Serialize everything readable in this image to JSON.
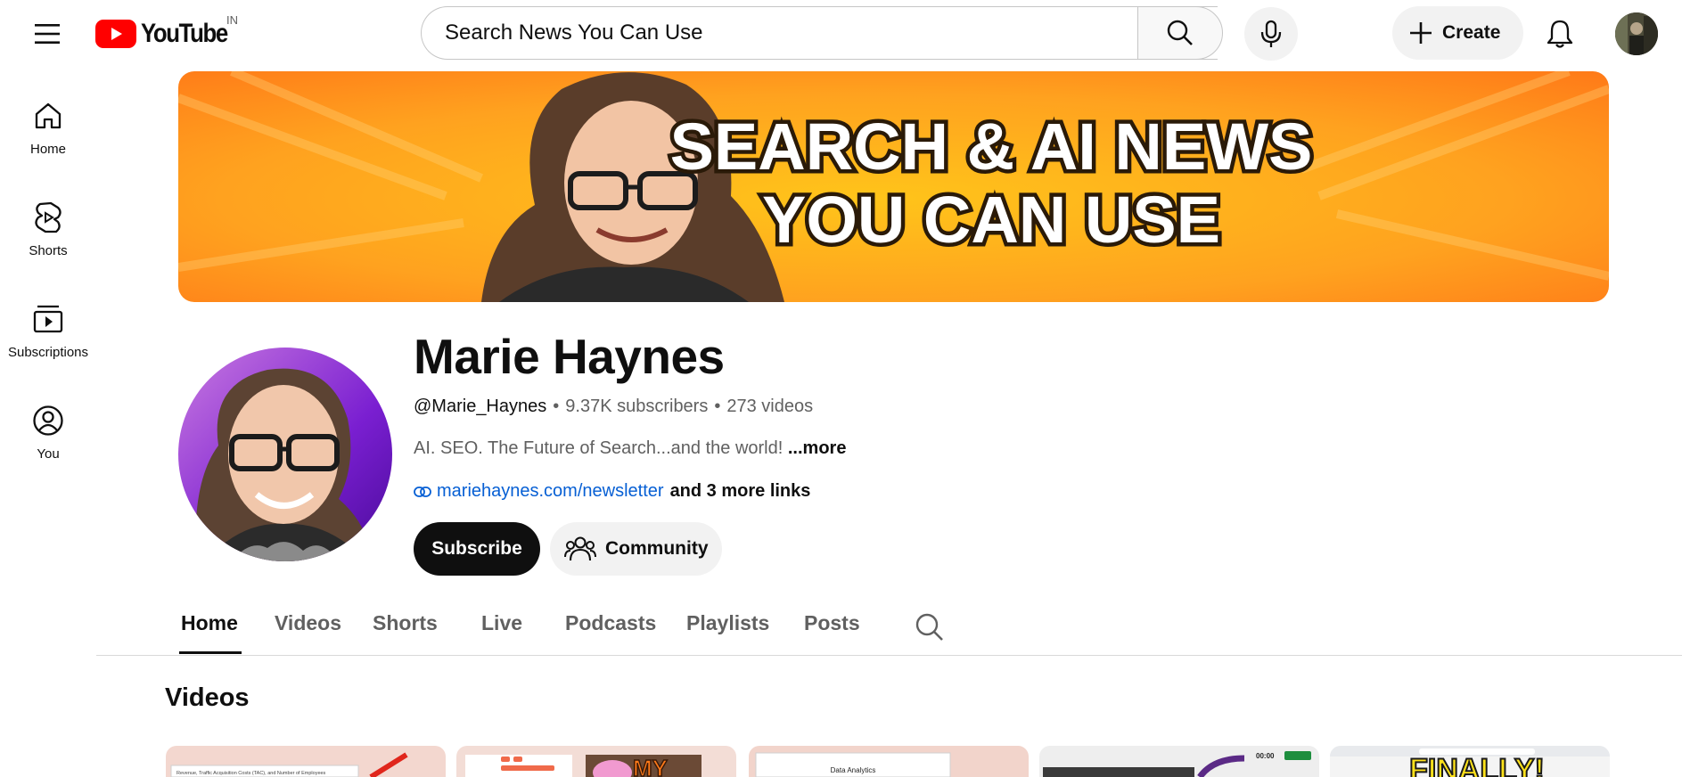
{
  "header": {
    "logo_text": "YouTube",
    "region": "IN",
    "search_value": "Search News You Can Use",
    "search_placeholder": "Search",
    "create_label": "Create"
  },
  "sidebar": {
    "items": [
      {
        "label": "Home"
      },
      {
        "label": "Shorts"
      },
      {
        "label": "Subscriptions"
      },
      {
        "label": "You"
      }
    ]
  },
  "banner": {
    "line1": "SEARCH & AI NEWS",
    "line2": "YOU CAN USE"
  },
  "channel": {
    "name": "Marie Haynes",
    "handle": "@Marie_Haynes",
    "subscribers": "9.37K subscribers",
    "videos": "273 videos",
    "description": "AI. SEO. The Future of Search...and the world!",
    "more": "...more",
    "link": "mariehaynes.com/newsletter",
    "more_links": "and 3 more links",
    "subscribe_label": "Subscribe",
    "community_label": "Community"
  },
  "tabs": [
    {
      "label": "Home",
      "active": true
    },
    {
      "label": "Videos"
    },
    {
      "label": "Shorts"
    },
    {
      "label": "Live"
    },
    {
      "label": "Podcasts"
    },
    {
      "label": "Playlists"
    },
    {
      "label": "Posts"
    }
  ],
  "section": {
    "title": "Videos"
  },
  "thumbnails": [
    {
      "text": "Revenue, Traffic Acquisition Costs (TAC), and Number of Employees"
    },
    {
      "text": "MY"
    },
    {
      "text": "Data Analytics"
    },
    {
      "text": "00:00"
    },
    {
      "text": "FINALLY!"
    }
  ],
  "colors": {
    "brand_red": "#ff0000",
    "link_blue": "#065fd4",
    "banner_orange": "#ff9a1f",
    "avatar_purple": "#7a1fd1"
  }
}
